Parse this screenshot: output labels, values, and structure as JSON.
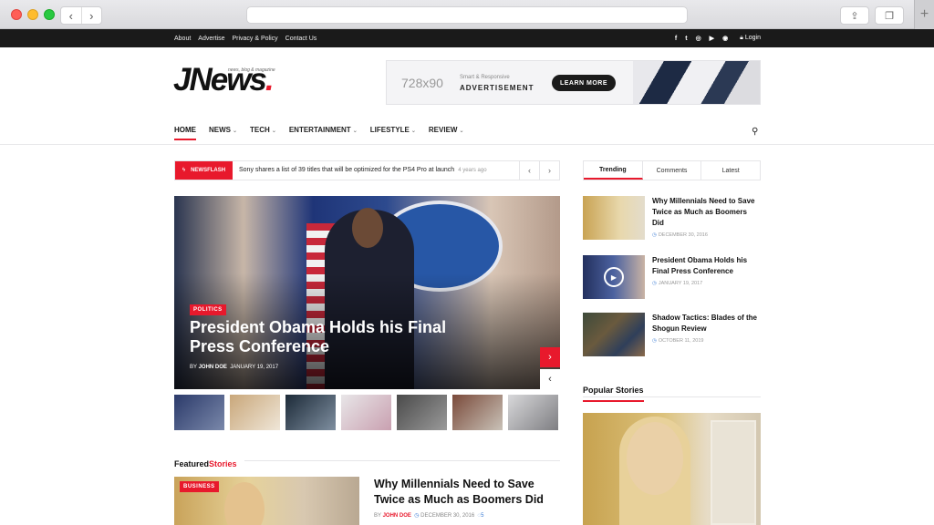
{
  "topbar": {
    "links": [
      "About",
      "Advertise",
      "Privacy & Policy",
      "Contact Us"
    ],
    "social_icons": [
      "facebook-icon",
      "twitter-icon",
      "instagram-icon",
      "youtube-icon",
      "rss-icon"
    ],
    "social_glyphs": [
      "f",
      "t",
      "◎",
      "▶",
      "◉"
    ],
    "login": "Login"
  },
  "logo": {
    "text": "JNews",
    "dot": ".",
    "tagline": "news, blog & magazine"
  },
  "ad": {
    "size": "728x90",
    "line1": "Smart & Responsive",
    "line2": "ADVERTISEMENT",
    "button": "LEARN MORE"
  },
  "nav": {
    "items": [
      {
        "label": "HOME",
        "active": true
      },
      {
        "label": "NEWS"
      },
      {
        "label": "TECH"
      },
      {
        "label": "ENTERTAINMENT"
      },
      {
        "label": "LIFESTYLE"
      },
      {
        "label": "REVIEW"
      }
    ]
  },
  "newsflash": {
    "label": "NEWSFLASH",
    "text": "Sony shares a list of 39 titles that will be optimized for the PS4 Pro at launch",
    "ago": "4 years ago"
  },
  "hero": {
    "category": "POLITICS",
    "title": "President Obama Holds his Final Press Conference",
    "author": "JOHN DOE",
    "date": "JANUARY 19, 2017"
  },
  "featured": {
    "heading_a": "Featured",
    "heading_b": "Stories",
    "category": "BUSINESS",
    "title": "Why Millennials Need to Save Twice as Much as Boomers Did",
    "author": "JOHN DOE",
    "date": "DECEMBER 30, 2016",
    "comments": "5"
  },
  "sidebar": {
    "tabs": [
      {
        "label": "Trending",
        "active": true
      },
      {
        "label": "Latest"
      },
      {
        "label": "Comments"
      }
    ],
    "items": [
      {
        "title": "Why Millennials Need to Save Twice as Much as Boomers Did",
        "date": "DECEMBER 30, 2016"
      },
      {
        "title": "President Obama Holds his Final Press Conference",
        "date": "JANUARY 19, 2017"
      },
      {
        "title": "Shadow Tactics: Blades of the Shogun Review",
        "date": "OCTOBER 11, 2019"
      }
    ],
    "popular_heading": "Popular Stories"
  },
  "colors": {
    "accent": "#e8192c",
    "topbar": "#1a1a1a",
    "link_blue": "#3a7bd5"
  }
}
